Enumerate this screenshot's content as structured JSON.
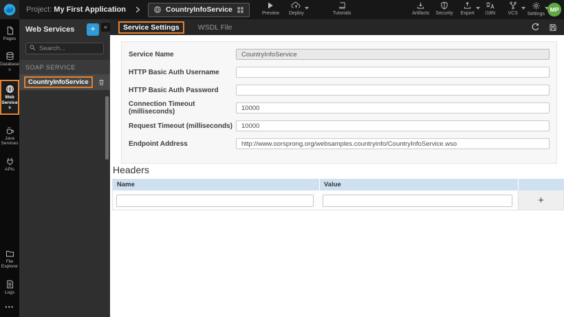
{
  "topbar": {
    "project_label": "Project:",
    "project_name": "My First Application",
    "service_tab": {
      "label": "CountryInfoService",
      "icon": "globe-icon",
      "menu_icon": "grid-icon"
    },
    "actions_center": [
      {
        "label": "Preview",
        "icon": "play-icon",
        "caret": false
      },
      {
        "label": "Deploy",
        "icon": "cloud-upload-icon",
        "caret": true
      },
      {
        "label": "Tutorials",
        "icon": "book-icon",
        "caret": false
      }
    ],
    "actions_right": [
      {
        "label": "Artifacts",
        "icon": "download-tray-icon",
        "caret": false
      },
      {
        "label": "Security",
        "icon": "shield-icon",
        "caret": false
      },
      {
        "label": "Export",
        "icon": "upload-tray-icon",
        "caret": true
      },
      {
        "label": "I18N",
        "icon": "translate-icon",
        "caret": false
      },
      {
        "label": "VCS",
        "icon": "branch-icon",
        "caret": true
      },
      {
        "label": "Settings",
        "icon": "gear-icon",
        "caret": true
      }
    ],
    "avatar_initials": "MP"
  },
  "sidebar": {
    "items": [
      {
        "label": "Pages",
        "icon": "page-icon",
        "active": false
      },
      {
        "label": "Databases",
        "icon": "database-icon",
        "active": false
      },
      {
        "label": "Web Services",
        "icon": "globe-icon",
        "active": true
      },
      {
        "label": "Java Services",
        "icon": "coffee-icon",
        "active": false
      },
      {
        "label": "APIs",
        "icon": "plug-icon",
        "active": false
      }
    ],
    "bottom_items": [
      {
        "label": "File Explorer",
        "icon": "folder-icon"
      },
      {
        "label": "Logs",
        "icon": "document-icon"
      }
    ],
    "more_label": "•••"
  },
  "panel": {
    "title": "Web Services",
    "add_label": "+",
    "collapse_label": "«",
    "search_placeholder": "Search...",
    "section_label": "SOAP SERVICE",
    "items": [
      {
        "label": "CountryInfoService",
        "active": true,
        "action_icon": "trash-icon"
      }
    ]
  },
  "main": {
    "tabs": [
      {
        "label": "Service Settings",
        "active": true
      },
      {
        "label": "WSDL File",
        "active": false
      }
    ],
    "toolbar_icons": [
      "refresh-icon",
      "save-icon"
    ],
    "form": {
      "fields": [
        {
          "label": "Service Name",
          "value": "CountryInfoService",
          "disabled": true
        },
        {
          "label": "HTTP Basic Auth Username",
          "value": ""
        },
        {
          "label": "HTTP Basic Auth Password",
          "value": ""
        },
        {
          "label": "Connection Timeout (milliseconds)",
          "value": "10000"
        },
        {
          "label": "Request Timeout (milliseconds)",
          "value": "10000"
        },
        {
          "label": "Endpoint Address",
          "value": "http://www.oorsprong.org/websamples.countryinfo/CountryInfoService.wso"
        }
      ]
    },
    "headers_section": {
      "title": "Headers",
      "columns": [
        "Name",
        "Value"
      ],
      "add_label": "+",
      "rows": [
        {
          "name": "",
          "value": ""
        }
      ]
    }
  },
  "colors": {
    "accent_orange": "#E5822E",
    "accent_blue": "#2E9BD6",
    "avatar_green": "#5FA844",
    "table_header_blue": "#CFE1F0",
    "topbar_bg": "#171717",
    "panel_bg": "#2F2F2F"
  }
}
